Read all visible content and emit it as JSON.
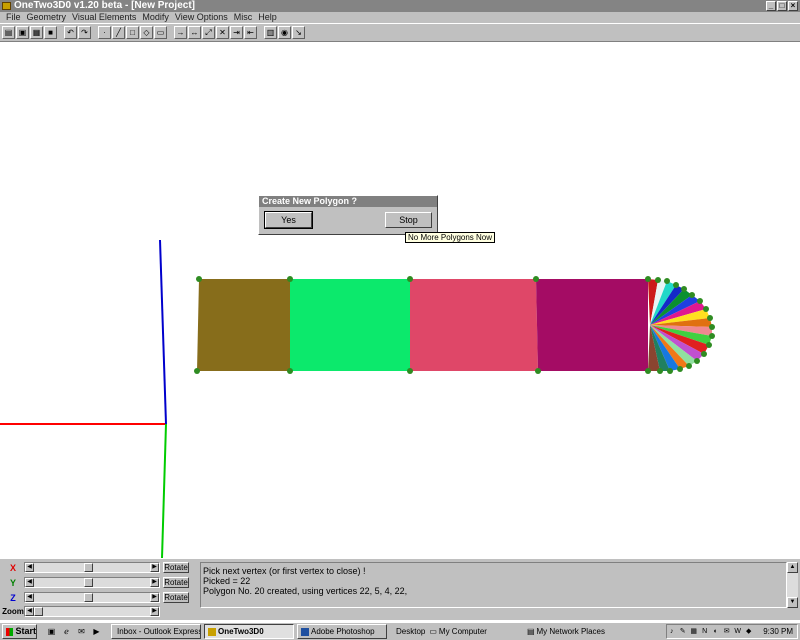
{
  "window": {
    "title": "OneTwo3D0 v1.20 beta - [New Project]",
    "btn_min": "_",
    "btn_max": "□",
    "btn_close": "×"
  },
  "menu": [
    "File",
    "Geometry",
    "Visual Elements",
    "Modify",
    "View Options",
    "Misc",
    "Help"
  ],
  "toolbar_icons": [
    "open-icon",
    "save-icon",
    "save-all-icon",
    "disk-icon",
    "undo-icon",
    "redo-icon",
    "vertex-icon",
    "line-icon",
    "square-icon",
    "polygon-icon",
    "image-icon",
    "move-icon",
    "move-both-icon",
    "scale-icon",
    "rotate-icon",
    "mirror-icon",
    "extrude-icon",
    "texture-icon",
    "view-icon",
    "help-icon"
  ],
  "dialog": {
    "title": "Create New Polygon ?",
    "yes": "Yes",
    "stop": "Stop"
  },
  "tooltip": "No More Polygons Now",
  "controls": {
    "x_label": "X",
    "y_label": "Y",
    "z_label": "Z",
    "zoom_label": "Zoom",
    "rotate": "Rotate",
    "x_level": 0.47,
    "y_level": 0.47,
    "z_level": 0.47,
    "zoom_level": 0.0
  },
  "messages": [
    "Pick next vertex (or first vertex to close) !",
    "Picked = 22",
    "Polygon No. 20 created, using vertices 22, 5, 4, 22,"
  ],
  "taskbar": {
    "start": "Start",
    "tasks": [
      {
        "label": "Inbox - Outlook Express",
        "active": false
      },
      {
        "label": "OneTwo3D0",
        "active": true
      },
      {
        "label": "Adobe Photoshop",
        "active": false
      }
    ],
    "desktop": "Desktop",
    "my_computer": "My Computer",
    "network": "My Network Places",
    "clock": "9:30 PM"
  },
  "colors": {
    "poly1": "#876d1b",
    "poly2": "#0ce96c",
    "poly3": "#df4768",
    "poly4": "#a40c64",
    "vertex": "#2f8c22",
    "axis_x": "#ff0000",
    "axis_y": "#0000cc",
    "axis_z": "#00cc00"
  }
}
